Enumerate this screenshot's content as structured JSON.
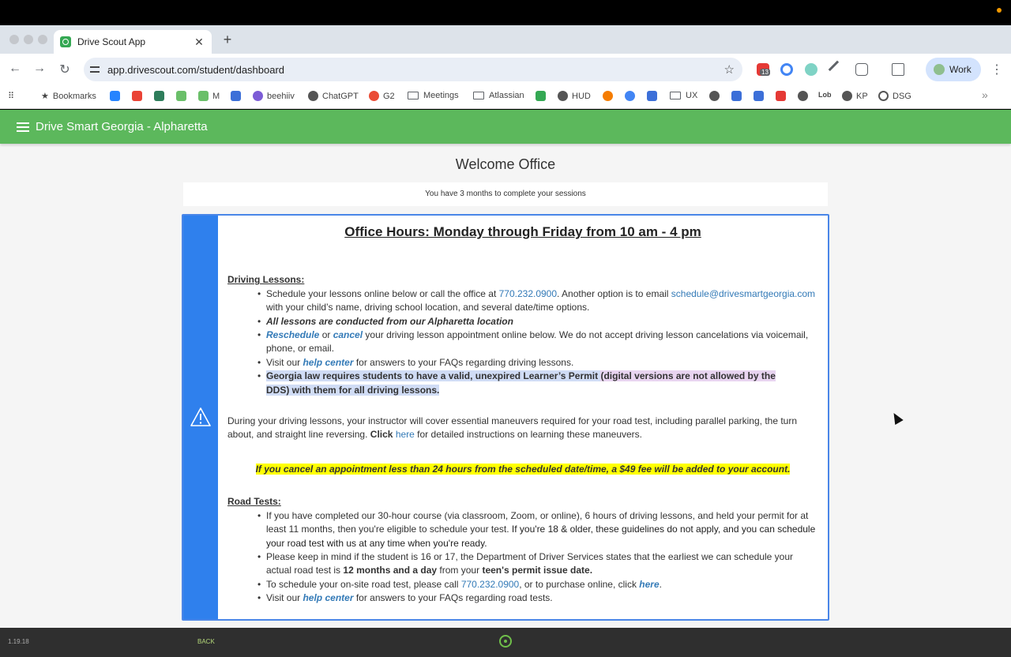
{
  "browser": {
    "tab_title": "Drive Scout App",
    "tab_close": "✕",
    "new_tab": "+",
    "url": "app.drivescout.com/student/dashboard",
    "star": "☆",
    "extension_badge": "13",
    "profile_label": "Work",
    "menu": "⋮",
    "nav": {
      "back": "←",
      "forward": "→",
      "reload": "↻"
    },
    "bookmarks": [
      {
        "label": "Bookmarks",
        "icon": "star-icon"
      },
      {
        "label": "",
        "icon": "atlassian-icon",
        "color": "#2684ff"
      },
      {
        "label": "",
        "icon": "gmail-icon",
        "color": "#ea4335"
      },
      {
        "label": "",
        "icon": "s-icon",
        "color": "#2e7d5b"
      },
      {
        "label": "",
        "icon": "green-icon",
        "color": "#6abf69"
      },
      {
        "label": "M",
        "icon": "meet-icon",
        "color": "#6abf69"
      },
      {
        "label": "",
        "icon": "dropbox-icon",
        "color": "#3c6fd8"
      },
      {
        "label": "beehiiv",
        "icon": "beehiiv-icon",
        "color": "#7c5cd6"
      },
      {
        "label": "ChatGPT",
        "icon": "chatgpt-icon",
        "color": "#555555"
      },
      {
        "label": "G2",
        "icon": "g2-icon",
        "color": "#ea4b35"
      },
      {
        "label": "Meetings",
        "icon": "folder-icon"
      },
      {
        "label": "Atlassian",
        "icon": "folder-icon"
      },
      {
        "label": "",
        "icon": "drive-icon",
        "color": "#34a853"
      },
      {
        "label": "HUD",
        "icon": "globe-icon",
        "color": "#555555"
      },
      {
        "label": "",
        "icon": "todoist-icon",
        "color": "#f57c00"
      },
      {
        "label": "",
        "icon": "blue-dot-icon",
        "color": "#4285f4"
      },
      {
        "label": "",
        "icon": "grid-icon",
        "color": "#3c6fd8"
      },
      {
        "label": "UX",
        "icon": "folder-icon"
      },
      {
        "label": "",
        "icon": "globe-icon",
        "color": "#555555"
      },
      {
        "label": "",
        "icon": "i-icon",
        "color": "#3c6fd8"
      },
      {
        "label": "",
        "icon": "calendar-icon",
        "color": "#3c6fd8"
      },
      {
        "label": "",
        "icon": "s-red-icon",
        "color": "#e53935"
      },
      {
        "label": "",
        "icon": "globe-icon",
        "color": "#555555"
      },
      {
        "label": "Lob",
        "icon": "lob-icon"
      },
      {
        "label": "KP",
        "icon": "globe-icon",
        "color": "#555555"
      },
      {
        "label": "DSG",
        "icon": "steering-wheel-icon",
        "color": "#555555"
      }
    ],
    "overflow": "»"
  },
  "app": {
    "title": "Drive Smart Georgia - Alpharetta",
    "welcome": "Welcome Office",
    "notice": "You have 3 months to complete your sessions",
    "card": {
      "title": "Office Hours: Monday through Friday from 10 am - 4 pm",
      "driving_heading": "Driving Lessons:",
      "b1_a": "Schedule your lessons online below or call the office at ",
      "b1_phone": "770.232.0900",
      "b1_b": ". Another option is to email ",
      "b1_email": "schedule@drivesmartgeorgia.com",
      "b1_c": " with your child’s name, driving school location, and several date/time options.",
      "b2": "All lessons are conducted from our Alpharetta location",
      "b3_resched": "Reschedule",
      "b3_or": " or ",
      "b3_cancel": "cancel",
      "b3_rest": " your driving lesson appointment online below.  We do not accept driving lesson cancelations via voicemail, phone, or email.",
      "b4_a": "Visit our ",
      "b4_help": "help center",
      "b4_b": " for answers to your FAQs regarding driving lessons.",
      "b5_a": "Georgia law requires students to have a valid, unexpired Learner’s Permit ",
      "b5_p": "(digital versions are not allowed by the",
      "b5_b": "DDS) with them for all driving lessons.",
      "para_a": "During your driving lessons, your instructor will cover essential maneuvers required for your road test, including parallel parking, the turn about, and straight line reversing. ",
      "para_click": "Click",
      "para_here": "here",
      "para_b": " for detailed instructions on learning these maneuvers.",
      "fee": "If you cancel an appointment less than 24 hours from the scheduled date/time, a $49 fee will be added to your account.",
      "road_heading": "Road Tests:",
      "r1_a": "If you have completed our 30-hour course (via classroom, Zoom, or online), 6 hours of driving lessons, and held your permit for at least 11 months, then you're eligible to schedule your test. ",
      "r1_b": "If you're 18 & older, these guidelines do not apply, and you can schedule your road test with us at any time when you're ready.",
      "r2_a": "Please keep in mind if the student is 16 or 17, the Department of Driver Services states that the earliest we can schedule your actual road test is ",
      "r2_bold1": "12 months and a day",
      "r2_b": " from your ",
      "r2_bold2": "teen's permit issue date.",
      "r3_a": "To schedule your on-site road test, please call ",
      "r3_phone": "770.232.0900",
      "r3_b": ", or to purchase online, click ",
      "r3_here": "here",
      "r3_c": ".",
      "r4_a": "Visit our ",
      "r4_help": "help center",
      "r4_b": " for answers to your FAQs regarding road tests."
    }
  },
  "footer": {
    "version": "1.19.18",
    "back": "BACK"
  }
}
